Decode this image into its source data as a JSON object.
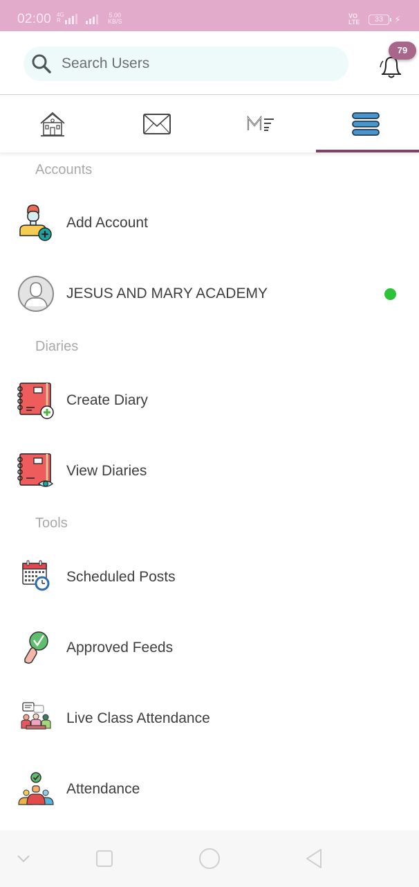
{
  "status_bar": {
    "time": "02:00",
    "network_type": "4G",
    "roaming": "R",
    "speed_value": "5.00",
    "speed_unit": "KB/S",
    "volte_top": "VO",
    "volte_bottom": "LTE",
    "battery": "33",
    "charging_icon": "bolt-icon"
  },
  "header": {
    "search_placeholder": "Search Users",
    "search_value": "",
    "notification_count": "79"
  },
  "tabs": [
    {
      "name": "home",
      "icon": "home-icon",
      "active": false
    },
    {
      "name": "messages",
      "icon": "mail-icon",
      "active": false
    },
    {
      "name": "me",
      "icon": "me-icon",
      "active": false
    },
    {
      "name": "menu",
      "icon": "hamburger-menu-icon",
      "active": true
    }
  ],
  "colors": {
    "status_bar": "#e2aacb",
    "accent": "#7a4565",
    "badge": "#a8668b",
    "menu_icon_blue": "#4a95cc",
    "online": "#2ec23a",
    "search_bg": "#eef9f9"
  },
  "sections": {
    "accounts": {
      "title": "Accounts",
      "items": [
        {
          "label": "Add Account",
          "icon": "add-user-icon"
        },
        {
          "label": "JESUS AND MARY ACADEMY",
          "icon": "avatar-icon",
          "status": "online"
        }
      ]
    },
    "diaries": {
      "title": "Diaries",
      "items": [
        {
          "label": "Create Diary",
          "icon": "diary-add-icon"
        },
        {
          "label": "View Diaries",
          "icon": "diary-view-icon"
        }
      ]
    },
    "tools": {
      "title": "Tools",
      "items": [
        {
          "label": "Scheduled Posts",
          "icon": "calendar-clock-icon"
        },
        {
          "label": "Approved Feeds",
          "icon": "approved-hand-icon"
        },
        {
          "label": "Live Class Attendance",
          "icon": "live-class-icon"
        },
        {
          "label": "Attendance",
          "icon": "attendance-icon"
        }
      ]
    }
  },
  "nav_bar": {
    "buttons": [
      "collapse",
      "recents",
      "home",
      "back"
    ]
  }
}
